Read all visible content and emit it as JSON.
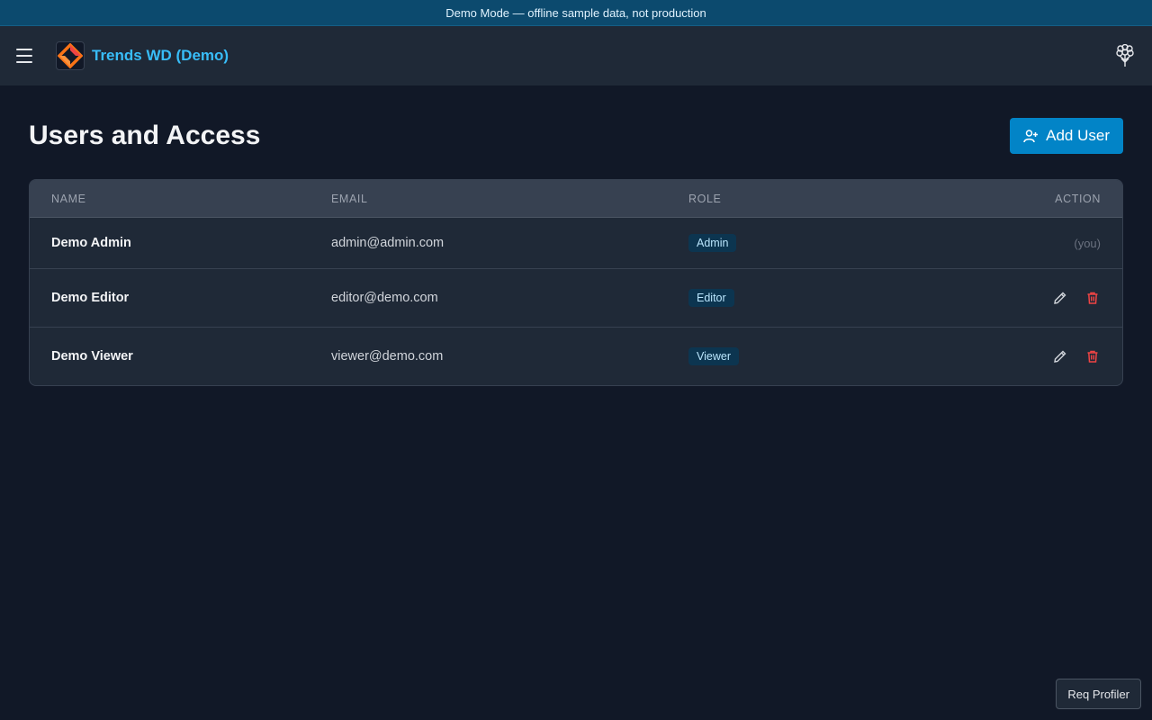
{
  "banner": {
    "text": "Demo Mode — offline sample data, not production"
  },
  "header": {
    "app_title": "Trends WD (Demo)",
    "menu_icon": "hamburger-icon",
    "logo_icon": "app-logo",
    "right_icon": "brain-icon"
  },
  "page": {
    "title": "Users and Access",
    "add_user_label": "Add User"
  },
  "table": {
    "columns": {
      "name": "NAME",
      "email": "EMAIL",
      "role": "ROLE",
      "action": "ACTION"
    },
    "rows": [
      {
        "name": "Demo Admin",
        "email": "admin@admin.com",
        "role": "Admin",
        "action_text": "(you)"
      },
      {
        "name": "Demo Editor",
        "email": "editor@demo.com",
        "role": "Editor"
      },
      {
        "name": "Demo Viewer",
        "email": "viewer@demo.com",
        "role": "Viewer"
      }
    ]
  },
  "footer": {
    "profiler_label": "Req Profiler"
  },
  "colors": {
    "accent": "#0284c7",
    "title": "#38bdf8",
    "danger": "#ef4444",
    "bg": "#111827",
    "panel": "#1f2937"
  }
}
